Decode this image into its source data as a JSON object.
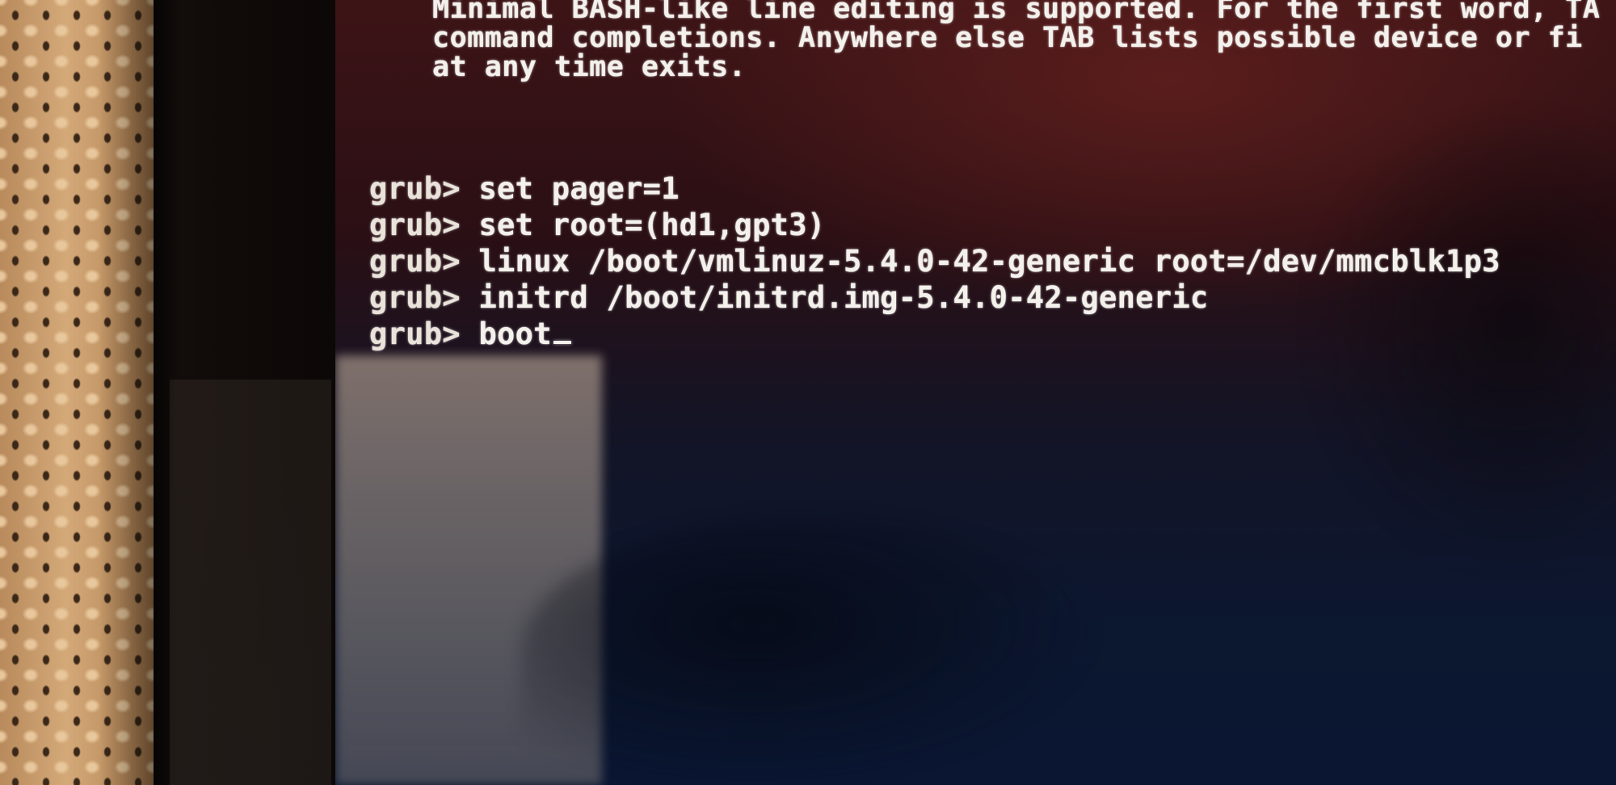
{
  "terminal": {
    "help_lines": [
      "Minimal BASH-like line editing is supported. For the first word, TA",
      "command completions. Anywhere else TAB lists possible device or fi",
      "at any time exits."
    ],
    "prompt": "grub>",
    "commands": [
      "set pager=1",
      "set root=(hd1,gpt3)",
      "linux /boot/vmlinuz-5.4.0-42-generic root=/dev/mmcblk1p3",
      "initrd /boot/initrd.img-5.4.0-42-generic",
      "boot"
    ]
  }
}
